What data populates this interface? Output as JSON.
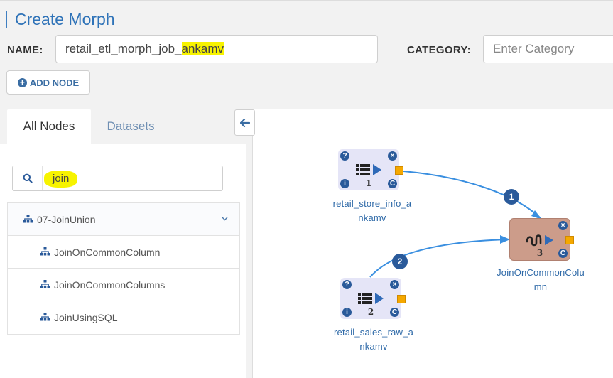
{
  "header": {
    "title": "Create Morph"
  },
  "form": {
    "name_label": "NAME:",
    "name_value_prefix": "retail_etl_morph_job_",
    "name_value_highlight": "ankamv",
    "category_label": "CATEGORY:",
    "category_placeholder": "Enter Category"
  },
  "toolbar": {
    "add_node_label": "ADD NODE"
  },
  "tabs": [
    {
      "label": "All Nodes",
      "active": true
    },
    {
      "label": "Datasets",
      "active": false
    }
  ],
  "search": {
    "value": "join"
  },
  "tree": {
    "group_label": "07-JoinUnion",
    "items": [
      {
        "label": "JoinOnCommonColumn"
      },
      {
        "label": "JoinOnCommonColumns"
      },
      {
        "label": "JoinUsingSQL"
      }
    ]
  },
  "canvas": {
    "nodes": [
      {
        "id": "1",
        "label_line1": "retail_store_info_a",
        "label_line2": "nkamv",
        "kind": "source"
      },
      {
        "id": "2",
        "label_line1": "retail_sales_raw_a",
        "label_line2": "nkamv",
        "kind": "source"
      },
      {
        "id": "3",
        "label_line1": "JoinOnCommonColu",
        "label_line2": "mn",
        "kind": "join"
      }
    ],
    "edges": [
      {
        "label": "1",
        "from": "1",
        "to": "3"
      },
      {
        "label": "2",
        "from": "2",
        "to": "3"
      }
    ],
    "badge_help": "?",
    "badge_close": "×",
    "badge_info": "i",
    "badge_config": "C"
  },
  "colors": {
    "accent": "#2f73b8",
    "highlight": "#f7f300",
    "port": "#f5a800",
    "join_node": "#cc9c8a",
    "source_node": "#e5e5f7",
    "edge": "#3a8fe0"
  }
}
